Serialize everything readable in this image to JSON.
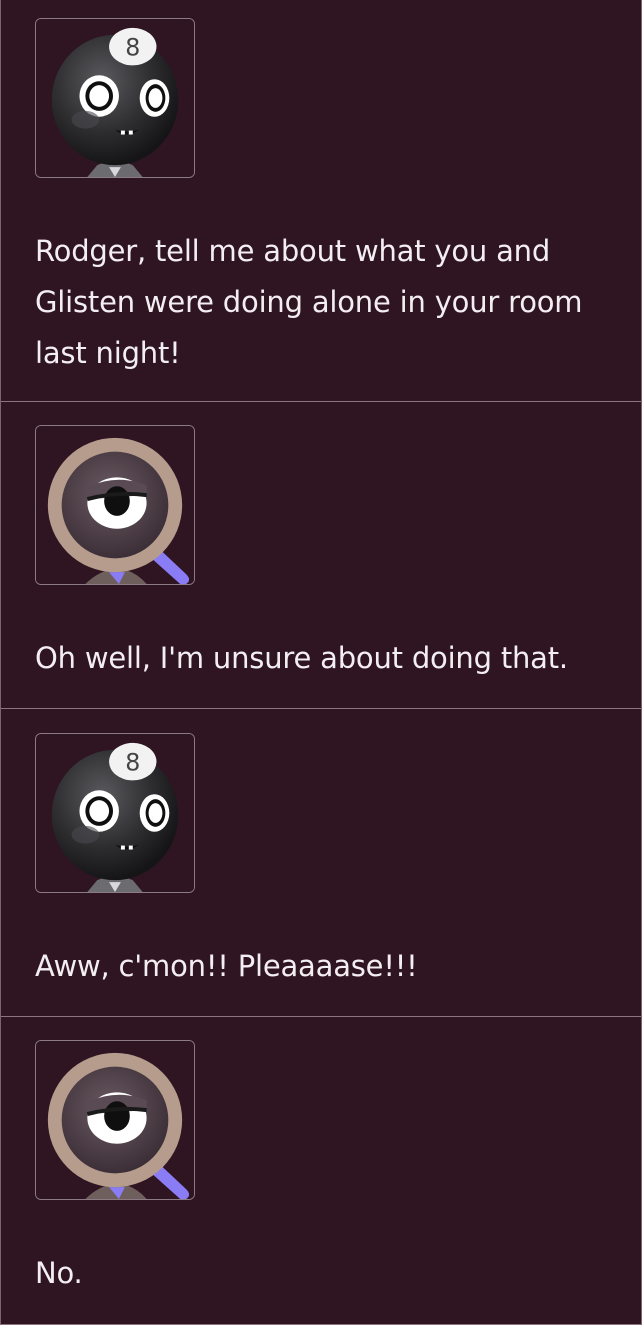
{
  "messages": [
    {
      "speaker_icon": "eight-ball-character-icon",
      "text": "Rodger, tell me about what you and Glisten were doing alone in your room last night!"
    },
    {
      "speaker_icon": "magnifying-glass-character-icon",
      "text": "Oh well, I'm unsure about doing that."
    },
    {
      "speaker_icon": "eight-ball-character-icon",
      "text": "Aww, c'mon!! Pleaaaase!!!"
    },
    {
      "speaker_icon": "magnifying-glass-character-icon",
      "text": "No."
    }
  ],
  "colors": {
    "background": "#2f1422",
    "text": "#f3eef1",
    "divider": "#8a7480",
    "accent_handle": "#8a7cf4"
  }
}
